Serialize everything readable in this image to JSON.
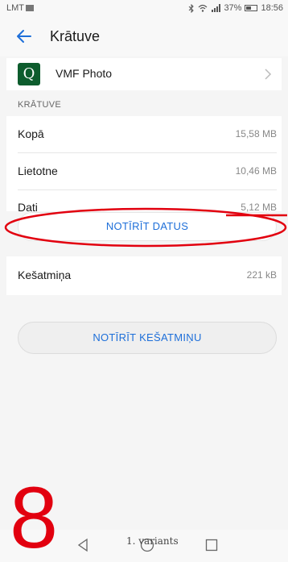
{
  "status_bar": {
    "carrier": "LMT",
    "battery": "37%",
    "time": "18:56",
    "battery_level": 0.37,
    "icons": [
      "image-icon",
      "bluetooth-icon",
      "wifi-icon",
      "signal-icon",
      "battery-icon"
    ]
  },
  "header": {
    "title": "Krātuve",
    "back_icon": "arrow-left-icon"
  },
  "app": {
    "name": "VMF Photo",
    "icon_letter": "Q",
    "icon_color": "#0d5c2d"
  },
  "storage": {
    "section_label": "KRĀTUVE",
    "rows": [
      {
        "label": "Kopā",
        "value": "15,58 MB"
      },
      {
        "label": "Lietotne",
        "value": "10,46 MB"
      },
      {
        "label": "Dati",
        "value": "5,12 MB"
      }
    ],
    "clear_data_label": "NOTĪRĪT DATUS"
  },
  "cache": {
    "label": "Kešatmiņa",
    "value": "221 kB",
    "clear_cache_label": "NOTĪRĪT KEŠATMIŅU"
  },
  "overlay": {
    "step_number": "8",
    "variant_text": "1. variants",
    "annotation_color": "#e2000f"
  },
  "colors": {
    "accent": "#1e6fd9",
    "background": "#f5f5f5"
  }
}
